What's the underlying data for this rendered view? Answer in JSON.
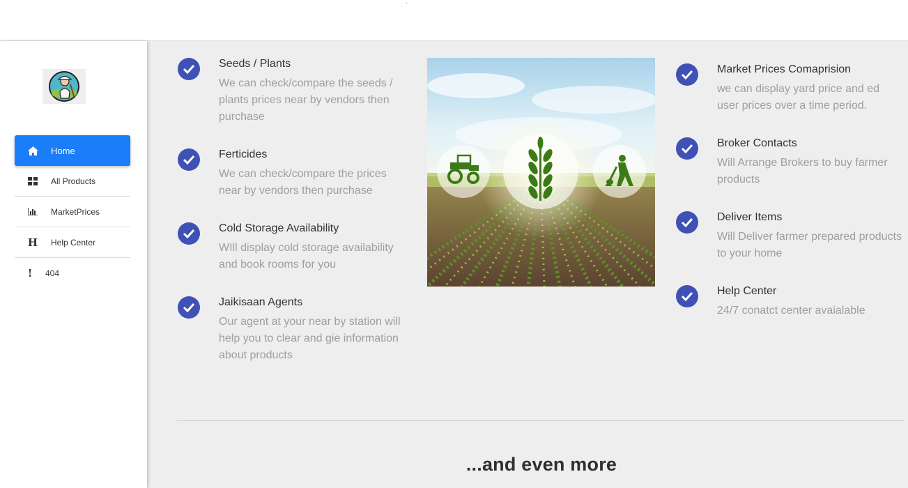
{
  "header": {
    "mark": "."
  },
  "sidebar": {
    "logo": "farmer-logo",
    "items": [
      {
        "label": "Home",
        "icon": "home-icon",
        "active": true
      },
      {
        "label": "All Products",
        "icon": "grid-icon"
      },
      {
        "label": "MarketPrices",
        "icon": "bar-chart-icon"
      },
      {
        "label": "Help Center",
        "icon": "h-icon",
        "glyph": "H"
      },
      {
        "label": "404",
        "icon": "exclamation-icon",
        "glyph": "!"
      }
    ]
  },
  "features": {
    "left": [
      {
        "title": "Seeds / Plants",
        "desc": "We can check/compare the seeds / plants prices near by vendors then purchase"
      },
      {
        "title": "Ferticides",
        "desc": "We can check/compare the prices near by vendors then purchase"
      },
      {
        "title": "Cold Storage Availability",
        "desc": "WIll display cold storage availability and book rooms for you"
      },
      {
        "title": "Jaikisaan Agents",
        "desc": "Our agent at your near by station will help you to clear and gie information about products"
      }
    ],
    "right": [
      {
        "title": "Market Prices Comaprision",
        "desc": "we can display yard price and ed user prices over a time period."
      },
      {
        "title": "Broker Contacts",
        "desc": "Will Arrange Brokers to buy farmer products"
      },
      {
        "title": "Deliver Items",
        "desc": "Will Deliver farmer prepared products to your home"
      },
      {
        "title": "Help Center",
        "desc": "24/7 conatct center avaialable"
      }
    ]
  },
  "photo": {
    "icons": [
      "tractor-icon",
      "wheat-icon",
      "farmer-digging-icon"
    ]
  },
  "footer": {
    "more": "...and even more"
  },
  "colors": {
    "accent": "#1a7dfa",
    "check": "#3f51b5",
    "background": "#eeeeee"
  }
}
